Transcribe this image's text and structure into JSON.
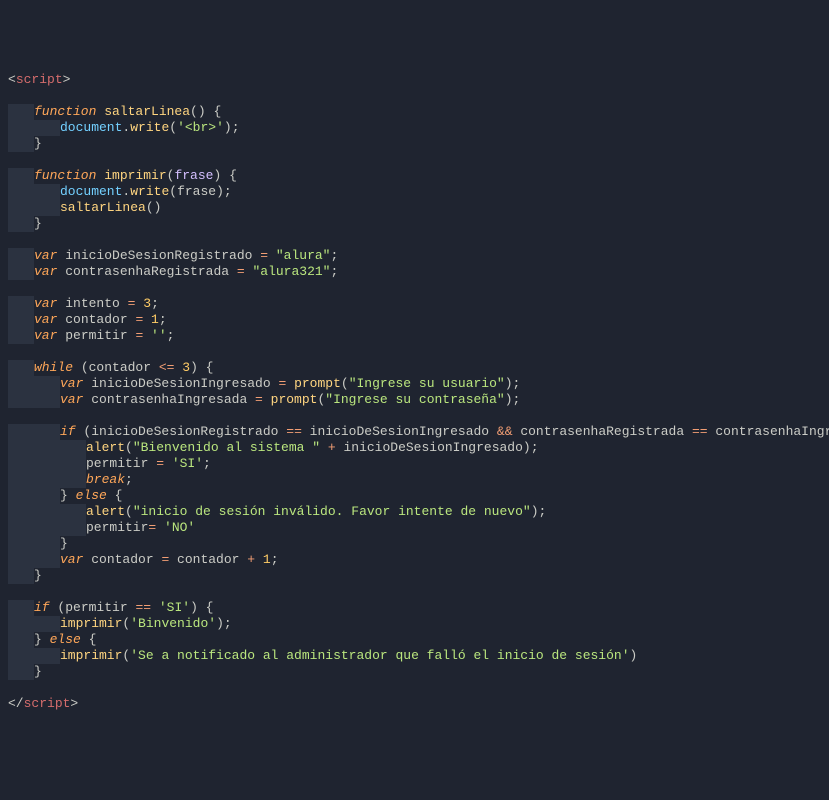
{
  "code": {
    "lines": [
      [
        {
          "t": "<",
          "c": "pun"
        },
        {
          "t": "script",
          "c": "tag"
        },
        {
          "t": ">",
          "c": "pun"
        }
      ],
      [],
      [
        {
          "t": "    ",
          "c": "pad1"
        },
        {
          "t": "function ",
          "c": "kw"
        },
        {
          "t": "saltarLinea",
          "c": "fn"
        },
        {
          "t": "(",
          "c": "pun"
        },
        {
          "t": ") ",
          "c": "pun"
        },
        {
          "t": "{",
          "c": "brace"
        }
      ],
      [
        {
          "t": "        ",
          "c": "pad2"
        },
        {
          "t": "document",
          "c": "obj"
        },
        {
          "t": ".",
          "c": "pun"
        },
        {
          "t": "write",
          "c": "call"
        },
        {
          "t": "(",
          "c": "pun"
        },
        {
          "t": "'<br>'",
          "c": "str"
        },
        {
          "t": ")",
          "c": "pun"
        },
        {
          "t": ";",
          "c": "pun"
        }
      ],
      [
        {
          "t": "    ",
          "c": "pad1"
        },
        {
          "t": "}",
          "c": "brace"
        }
      ],
      [],
      [
        {
          "t": "    ",
          "c": "pad1"
        },
        {
          "t": "function ",
          "c": "kw"
        },
        {
          "t": "imprimir",
          "c": "fn"
        },
        {
          "t": "(",
          "c": "pun"
        },
        {
          "t": "frase",
          "c": "par"
        },
        {
          "t": ") ",
          "c": "pun"
        },
        {
          "t": "{",
          "c": "brace"
        }
      ],
      [
        {
          "t": "        ",
          "c": "pad2"
        },
        {
          "t": "document",
          "c": "obj"
        },
        {
          "t": ".",
          "c": "pun"
        },
        {
          "t": "write",
          "c": "call"
        },
        {
          "t": "(",
          "c": "pun"
        },
        {
          "t": "frase",
          "c": "var"
        },
        {
          "t": ")",
          "c": "pun"
        },
        {
          "t": ";",
          "c": "pun"
        }
      ],
      [
        {
          "t": "        ",
          "c": "pad2"
        },
        {
          "t": "saltarLinea",
          "c": "call"
        },
        {
          "t": "()",
          "c": "pun"
        }
      ],
      [
        {
          "t": "    ",
          "c": "pad1"
        },
        {
          "t": "}",
          "c": "brace"
        }
      ],
      [],
      [
        {
          "t": "    ",
          "c": "pad1"
        },
        {
          "t": "var ",
          "c": "kw"
        },
        {
          "t": "inicioDeSesionRegistrado ",
          "c": "var"
        },
        {
          "t": "= ",
          "c": "op"
        },
        {
          "t": "\"alura\"",
          "c": "str"
        },
        {
          "t": ";",
          "c": "pun"
        }
      ],
      [
        {
          "t": "    ",
          "c": "pad1"
        },
        {
          "t": "var ",
          "c": "kw"
        },
        {
          "t": "contrasenhaRegistrada ",
          "c": "var"
        },
        {
          "t": "= ",
          "c": "op"
        },
        {
          "t": "\"alura321\"",
          "c": "str"
        },
        {
          "t": ";",
          "c": "pun"
        }
      ],
      [],
      [
        {
          "t": "    ",
          "c": "pad1"
        },
        {
          "t": "var ",
          "c": "kw"
        },
        {
          "t": "intento ",
          "c": "var"
        },
        {
          "t": "= ",
          "c": "op"
        },
        {
          "t": "3",
          "c": "num"
        },
        {
          "t": ";",
          "c": "pun"
        }
      ],
      [
        {
          "t": "    ",
          "c": "pad1"
        },
        {
          "t": "var ",
          "c": "kw"
        },
        {
          "t": "contador ",
          "c": "var"
        },
        {
          "t": "= ",
          "c": "op"
        },
        {
          "t": "1",
          "c": "num"
        },
        {
          "t": ";",
          "c": "pun"
        }
      ],
      [
        {
          "t": "    ",
          "c": "pad1"
        },
        {
          "t": "var ",
          "c": "kw"
        },
        {
          "t": "permitir ",
          "c": "var"
        },
        {
          "t": "= ",
          "c": "op"
        },
        {
          "t": "''",
          "c": "str"
        },
        {
          "t": ";",
          "c": "pun"
        }
      ],
      [],
      [
        {
          "t": "    ",
          "c": "pad1"
        },
        {
          "t": "while ",
          "c": "kw"
        },
        {
          "t": "(",
          "c": "pun"
        },
        {
          "t": "contador ",
          "c": "var"
        },
        {
          "t": "<= ",
          "c": "op"
        },
        {
          "t": "3",
          "c": "num"
        },
        {
          "t": ") ",
          "c": "pun"
        },
        {
          "t": "{",
          "c": "brace"
        }
      ],
      [
        {
          "t": "        ",
          "c": "pad2"
        },
        {
          "t": "var ",
          "c": "kw"
        },
        {
          "t": "inicioDeSesionIngresado ",
          "c": "var"
        },
        {
          "t": "= ",
          "c": "op"
        },
        {
          "t": "prompt",
          "c": "call"
        },
        {
          "t": "(",
          "c": "pun"
        },
        {
          "t": "\"Ingrese su usuario\"",
          "c": "str"
        },
        {
          "t": ")",
          "c": "pun"
        },
        {
          "t": ";",
          "c": "pun"
        }
      ],
      [
        {
          "t": "        ",
          "c": "pad2"
        },
        {
          "t": "var ",
          "c": "kw"
        },
        {
          "t": "contrasenhaIngresada ",
          "c": "var"
        },
        {
          "t": "= ",
          "c": "op"
        },
        {
          "t": "prompt",
          "c": "call"
        },
        {
          "t": "(",
          "c": "pun"
        },
        {
          "t": "\"Ingrese su contraseña\"",
          "c": "str"
        },
        {
          "t": ")",
          "c": "pun"
        },
        {
          "t": ";",
          "c": "pun"
        }
      ],
      [],
      [
        {
          "t": "        ",
          "c": "pad2"
        },
        {
          "t": "if ",
          "c": "kw"
        },
        {
          "t": "(",
          "c": "pun"
        },
        {
          "t": "inicioDeSesionRegistrado ",
          "c": "var"
        },
        {
          "t": "== ",
          "c": "op"
        },
        {
          "t": "inicioDeSesionIngresado ",
          "c": "var"
        },
        {
          "t": "&& ",
          "c": "op"
        },
        {
          "t": "contrasenhaRegistrada ",
          "c": "var"
        },
        {
          "t": "== ",
          "c": "op"
        },
        {
          "t": "contrasenhaIngresada",
          "c": "var"
        },
        {
          "t": ") ",
          "c": "pun"
        },
        {
          "t": "{",
          "c": "brace"
        }
      ],
      [
        {
          "t": "            ",
          "c": "pad3"
        },
        {
          "t": "alert",
          "c": "call"
        },
        {
          "t": "(",
          "c": "pun"
        },
        {
          "t": "\"Bienvenido al sistema \"",
          "c": "str"
        },
        {
          "t": " + ",
          "c": "op"
        },
        {
          "t": "inicioDeSesionIngresado",
          "c": "var"
        },
        {
          "t": ")",
          "c": "pun"
        },
        {
          "t": ";",
          "c": "pun"
        }
      ],
      [
        {
          "t": "            ",
          "c": "pad3"
        },
        {
          "t": "permitir ",
          "c": "var"
        },
        {
          "t": "= ",
          "c": "op"
        },
        {
          "t": "'SI'",
          "c": "str"
        },
        {
          "t": ";",
          "c": "pun"
        }
      ],
      [
        {
          "t": "            ",
          "c": "pad3"
        },
        {
          "t": "break",
          "c": "kw"
        },
        {
          "t": ";",
          "c": "pun"
        }
      ],
      [
        {
          "t": "        ",
          "c": "pad2"
        },
        {
          "t": "} ",
          "c": "brace"
        },
        {
          "t": "else ",
          "c": "kw"
        },
        {
          "t": "{",
          "c": "brace"
        }
      ],
      [
        {
          "t": "            ",
          "c": "pad3"
        },
        {
          "t": "alert",
          "c": "call"
        },
        {
          "t": "(",
          "c": "pun"
        },
        {
          "t": "\"inicio de sesión inválido. Favor intente de nuevo\"",
          "c": "str"
        },
        {
          "t": ")",
          "c": "pun"
        },
        {
          "t": ";",
          "c": "pun"
        }
      ],
      [
        {
          "t": "            ",
          "c": "pad3"
        },
        {
          "t": "permitir",
          "c": "var"
        },
        {
          "t": "= ",
          "c": "op"
        },
        {
          "t": "'NO'",
          "c": "str"
        }
      ],
      [
        {
          "t": "        ",
          "c": "pad2"
        },
        {
          "t": "}",
          "c": "brace"
        }
      ],
      [
        {
          "t": "        ",
          "c": "pad2"
        },
        {
          "t": "var ",
          "c": "kw"
        },
        {
          "t": "contador ",
          "c": "var"
        },
        {
          "t": "= ",
          "c": "op"
        },
        {
          "t": "contador ",
          "c": "var"
        },
        {
          "t": "+ ",
          "c": "op"
        },
        {
          "t": "1",
          "c": "num"
        },
        {
          "t": ";",
          "c": "pun"
        }
      ],
      [
        {
          "t": "    ",
          "c": "pad1"
        },
        {
          "t": "}",
          "c": "brace"
        }
      ],
      [],
      [
        {
          "t": "    ",
          "c": "pad1"
        },
        {
          "t": "if ",
          "c": "kw"
        },
        {
          "t": "(",
          "c": "pun"
        },
        {
          "t": "permitir ",
          "c": "var"
        },
        {
          "t": "== ",
          "c": "op"
        },
        {
          "t": "'SI'",
          "c": "str"
        },
        {
          "t": ") ",
          "c": "pun"
        },
        {
          "t": "{",
          "c": "brace"
        }
      ],
      [
        {
          "t": "        ",
          "c": "pad2"
        },
        {
          "t": "imprimir",
          "c": "call"
        },
        {
          "t": "(",
          "c": "pun"
        },
        {
          "t": "'Binvenido'",
          "c": "str"
        },
        {
          "t": ")",
          "c": "pun"
        },
        {
          "t": ";",
          "c": "pun"
        }
      ],
      [
        {
          "t": "    ",
          "c": "pad1"
        },
        {
          "t": "} ",
          "c": "brace"
        },
        {
          "t": "else ",
          "c": "kw"
        },
        {
          "t": "{",
          "c": "brace"
        }
      ],
      [
        {
          "t": "        ",
          "c": "pad2"
        },
        {
          "t": "imprimir",
          "c": "call"
        },
        {
          "t": "(",
          "c": "pun"
        },
        {
          "t": "'Se a notificado al administrador que falló el inicio de sesión'",
          "c": "str"
        },
        {
          "t": ")",
          "c": "pun"
        }
      ],
      [
        {
          "t": "    ",
          "c": "pad1"
        },
        {
          "t": "}",
          "c": "brace"
        }
      ],
      [],
      [
        {
          "t": "</",
          "c": "pun"
        },
        {
          "t": "script",
          "c": "tag"
        },
        {
          "t": ">",
          "c": "pun"
        }
      ]
    ]
  }
}
